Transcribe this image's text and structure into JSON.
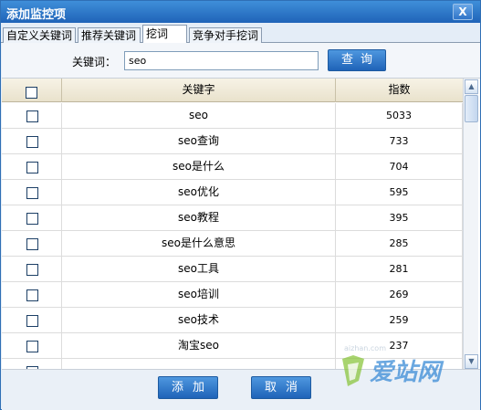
{
  "window": {
    "title": "添加监控项",
    "close_label": "X"
  },
  "tabs": [
    {
      "label": "自定义关键词",
      "active": false
    },
    {
      "label": "推荐关键词",
      "active": false
    },
    {
      "label": "挖词",
      "active": true
    },
    {
      "label": "竞争对手挖词",
      "active": false
    }
  ],
  "search": {
    "label": "关键词：",
    "value": "seo",
    "button_label": "查询"
  },
  "table": {
    "headers": {
      "keyword": "关键字",
      "index": "指数"
    },
    "rows": [
      {
        "keyword": "seo",
        "index": "5033"
      },
      {
        "keyword": "seo查询",
        "index": "733"
      },
      {
        "keyword": "seo是什么",
        "index": "704"
      },
      {
        "keyword": "seo优化",
        "index": "595"
      },
      {
        "keyword": "seo教程",
        "index": "395"
      },
      {
        "keyword": "seo是什么意思",
        "index": "285"
      },
      {
        "keyword": "seo工具",
        "index": "281"
      },
      {
        "keyword": "seo培训",
        "index": "269"
      },
      {
        "keyword": "seo技术",
        "index": "259"
      },
      {
        "keyword": "淘宝seo",
        "index": "237"
      },
      {
        "keyword": "",
        "index": ""
      }
    ]
  },
  "footer": {
    "add_label": "添加",
    "cancel_label": "取消"
  },
  "watermark": {
    "text": "爱站网",
    "url": "aizhan.com"
  },
  "colors": {
    "titlebar": "#1f63b8",
    "button": "#2f74c8",
    "header_bg": "#ede6d0",
    "watermark": "#3a8bd6"
  }
}
